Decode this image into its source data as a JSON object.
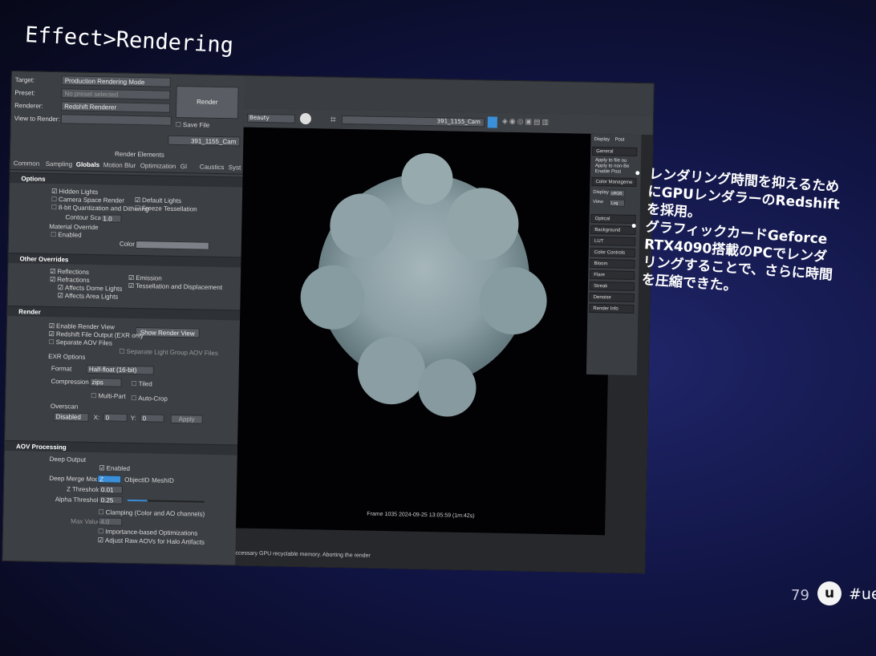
{
  "slide": {
    "title": "Effect>Rendering",
    "bullets": [
      "レンダリング時間を抑えるためにGPUレンダラーのRedshiftを採用。",
      "グラフィックカードGeforce RTX4090搭載のPCでレンダリングすることで、さらに時間を圧縮できた。"
    ],
    "page_number": "79",
    "logo_glyph": "u",
    "hashtag": "#uef"
  },
  "render_settings": {
    "target_label": "Target:",
    "target_value": "Production Rendering Mode",
    "preset_label": "Preset:",
    "preset_value": "No preset selected",
    "renderer_label": "Renderer:",
    "renderer_value": "Redshift Renderer",
    "view_label": "View to Render:",
    "view_value": "",
    "render_button": "Render",
    "save_file_label": "Save File",
    "camera_value": "391_1155_Cam",
    "render_elements_label": "Render Elements",
    "tabs": [
      "Common",
      "Sampling",
      "Globals",
      "Motion Blur",
      "Optimization",
      "GI",
      "Caustics",
      "Syst"
    ]
  },
  "options": {
    "header": "Options",
    "hidden_lights": "Hidden Lights",
    "default_lights": "Default Lights",
    "camera_space_render": "Camera Space Render",
    "freeze_tessellation": "Freeze Tessellation",
    "bit_quantization": "8-bit Quantization and Dithering",
    "contour_scale_label": "Contour Scale",
    "contour_scale_value": "1.0",
    "material_override": "Material Override",
    "enabled": "Enabled",
    "color_label": "Color"
  },
  "other_overrides": {
    "header": "Other Overrides",
    "reflections": "Reflections",
    "emission": "Emission",
    "refractions": "Refractions",
    "tessellation": "Tessellation and Displacement",
    "affects_dome": "Affects Dome Lights",
    "affects_area": "Affects Area Lights"
  },
  "render_section": {
    "header": "Render",
    "enable_render_view": "Enable Render View",
    "show_render_view": "Show Render View",
    "redshift_file_output": "Redshift File Output (EXR only",
    "separate_aov": "Separate AOV Files",
    "separate_light_group": "Separate Light Group AOV Files",
    "exr_options": "EXR Options",
    "format_label": "Format",
    "format_value": "Half-float (16-bit)",
    "compression_label": "Compression",
    "compression_value": "zips",
    "tiled": "Tiled",
    "multipart": "Multi-Part",
    "autocrop": "Auto-Crop",
    "overscan": "Overscan",
    "overscan_value": "Disabled",
    "x_label": "X:",
    "x_value": "0",
    "y_label": "Y:",
    "y_value": "0",
    "apply": "Apply"
  },
  "aov": {
    "header": "AOV Processing",
    "deep_output": "Deep Output",
    "enabled": "Enabled",
    "deep_merge_label": "Deep Merge Mode",
    "deep_merge_value": "Z",
    "object_id": "ObjectID",
    "mesh_id": "MeshID",
    "z_threshold_label": "Z Threshold",
    "z_threshold_value": "0.01",
    "alpha_threshold_label": "Alpha Threshold",
    "alpha_threshold_value": "0.25",
    "clamping": "Clamping (Color and AO channels)",
    "max_value_label": "Max Value",
    "max_value": "4.0",
    "importance": "Importance-based Optimizations",
    "adjust_raw": "Adjust Raw AOVs for Halo Artifacts"
  },
  "viewer": {
    "channel_dropdown": "Beauty",
    "camera_dropdown": "391_1155_Cam",
    "frame_info": "Frame 1035 2024-09-25 13:05:59 (1m:42s)",
    "status_message": "ccessary GPU recyclable memory. Aborting the render",
    "panel_tabs": [
      "Display",
      "Post"
    ],
    "general_label": "General",
    "general_items": [
      "Apply to file ou",
      "Apply to non-Be",
      "Enable Post"
    ],
    "color_management_label": "Color Manageme",
    "display_label": "Display",
    "display_value": "sRGB",
    "view_label": "View",
    "view_value": "Log",
    "sections": [
      "Optical",
      "Background",
      "LUT",
      "Color Controls",
      "Bloom",
      "Flare",
      "Streak",
      "Denoise",
      "Render Info"
    ]
  }
}
